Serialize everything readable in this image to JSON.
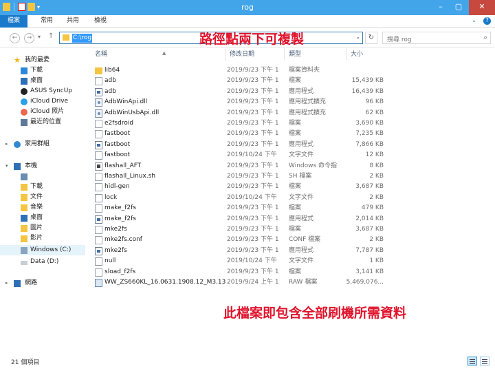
{
  "window": {
    "title": "rog"
  },
  "ribbon": {
    "tabs": [
      "檔案",
      "常用",
      "共用",
      "檢視"
    ]
  },
  "address": {
    "path": "C:\\rog",
    "search_placeholder": "搜尋 rog"
  },
  "annotations": {
    "path_note": "路徑點兩下可複製",
    "content_note": "此檔案即包含全部刷機所需資料"
  },
  "sidebar": {
    "favorites": "我的最愛",
    "fav_items": [
      "下載",
      "桌面",
      "ASUS SyncUp",
      "iCloud Drive",
      "iCloud 照片",
      "最近的位置"
    ],
    "homegroup": "家用群組",
    "thispc": "本機",
    "pc_items": [
      "",
      "下載",
      "文件",
      "音樂",
      "桌面",
      "圖片",
      "影片",
      "Windows (C:)",
      "Data (D:)"
    ],
    "network": "網路"
  },
  "columns": {
    "name": "名稱",
    "date": "修改日期",
    "type": "類型",
    "size": "大小"
  },
  "files": [
    {
      "name": "lib64",
      "date": "2019/9/23 下午 1...",
      "type": "檔案資料夾",
      "size": "",
      "icon": "folder-icon"
    },
    {
      "name": "adb",
      "date": "2019/9/23 下午 1...",
      "type": "檔案",
      "size": "15,439 KB",
      "icon": "file-icon"
    },
    {
      "name": "adb",
      "date": "2019/9/23 下午 1...",
      "type": "應用程式",
      "size": "16,439 KB",
      "icon": "exe-icon"
    },
    {
      "name": "AdbWinApi.dll",
      "date": "2019/9/23 下午 1...",
      "type": "應用程式擴充",
      "size": "96 KB",
      "icon": "dll-icon"
    },
    {
      "name": "AdbWinUsbApi.dll",
      "date": "2019/9/23 下午 1...",
      "type": "應用程式擴充",
      "size": "62 KB",
      "icon": "dll-icon"
    },
    {
      "name": "e2fsdroid",
      "date": "2019/9/23 下午 1...",
      "type": "檔案",
      "size": "3,690 KB",
      "icon": "file-icon"
    },
    {
      "name": "fastboot",
      "date": "2019/9/23 下午 1...",
      "type": "檔案",
      "size": "7,235 KB",
      "icon": "file-icon"
    },
    {
      "name": "fastboot",
      "date": "2019/9/23 下午 1...",
      "type": "應用程式",
      "size": "7,866 KB",
      "icon": "exe-icon"
    },
    {
      "name": "fastboot",
      "date": "2019/10/24 下午 ...",
      "type": "文字文件",
      "size": "12 KB",
      "icon": "txt-icon"
    },
    {
      "name": "flashall_AFT",
      "date": "2019/9/23 下午 1...",
      "type": "Windows 命令指...",
      "size": "8 KB",
      "icon": "cmd-icon"
    },
    {
      "name": "flashall_Linux.sh",
      "date": "2019/9/23 下午 1...",
      "type": "SH 檔案",
      "size": "2 KB",
      "icon": "file-icon"
    },
    {
      "name": "hidl-gen",
      "date": "2019/9/23 下午 1...",
      "type": "檔案",
      "size": "3,687 KB",
      "icon": "file-icon"
    },
    {
      "name": "lock",
      "date": "2019/10/24 下午 ...",
      "type": "文字文件",
      "size": "2 KB",
      "icon": "txt-icon"
    },
    {
      "name": "make_f2fs",
      "date": "2019/9/23 下午 1...",
      "type": "檔案",
      "size": "479 KB",
      "icon": "file-icon"
    },
    {
      "name": "make_f2fs",
      "date": "2019/9/23 下午 1...",
      "type": "應用程式",
      "size": "2,014 KB",
      "icon": "exe-icon"
    },
    {
      "name": "mke2fs",
      "date": "2019/9/23 下午 1...",
      "type": "檔案",
      "size": "3,687 KB",
      "icon": "file-icon"
    },
    {
      "name": "mke2fs.conf",
      "date": "2019/9/23 下午 1...",
      "type": "CONF 檔案",
      "size": "2 KB",
      "icon": "file-icon"
    },
    {
      "name": "mke2fs",
      "date": "2019/9/23 下午 1...",
      "type": "應用程式",
      "size": "7,787 KB",
      "icon": "exe-icon"
    },
    {
      "name": "null",
      "date": "2019/10/24 下午 ...",
      "type": "文字文件",
      "size": "1 KB",
      "icon": "txt-icon"
    },
    {
      "name": "sload_f2fs",
      "date": "2019/9/23 下午 1...",
      "type": "檔案",
      "size": "3,141 KB",
      "icon": "file-icon"
    },
    {
      "name": "WW_ZS660KL_16.0631.1908.12_M3.13...",
      "date": "2019/9/24 上午 10...",
      "type": "RAW 檔案",
      "size": "5,469,076...",
      "icon": "raw-icon"
    }
  ],
  "status": {
    "count": "21 個項目"
  }
}
